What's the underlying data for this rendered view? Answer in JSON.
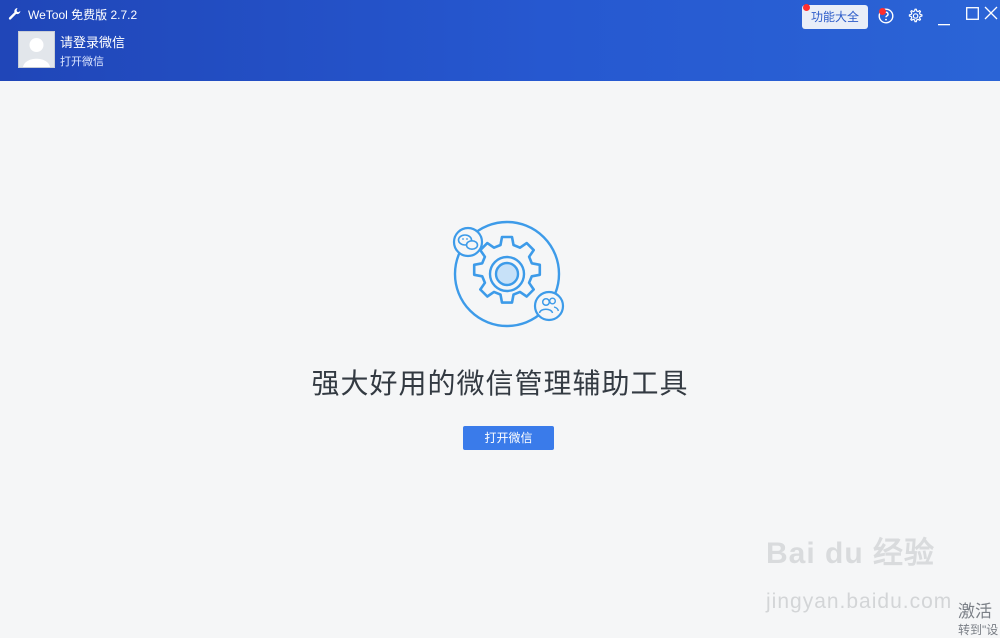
{
  "header": {
    "app_title": "WeTool 免费版 2.7.2",
    "user_name": "请登录微信",
    "user_sub": "打开微信",
    "feature_button": "功能大全",
    "accent": "#2658d0"
  },
  "main": {
    "slogan": "强大好用的微信管理辅助工具",
    "open_button": "打开微信",
    "button_color": "#3a7bea"
  },
  "watermark": {
    "logo_text": "Bai du 经验",
    "url": "jingyan.baidu.com"
  },
  "os_overlay": {
    "line1": "激活",
    "line2": "转到\"设"
  },
  "icons": [
    "wrench-icon",
    "help-icon",
    "settings-icon",
    "minimize-icon",
    "maximize-icon",
    "close-icon",
    "gear-icon",
    "wechat-icon",
    "users-icon"
  ]
}
